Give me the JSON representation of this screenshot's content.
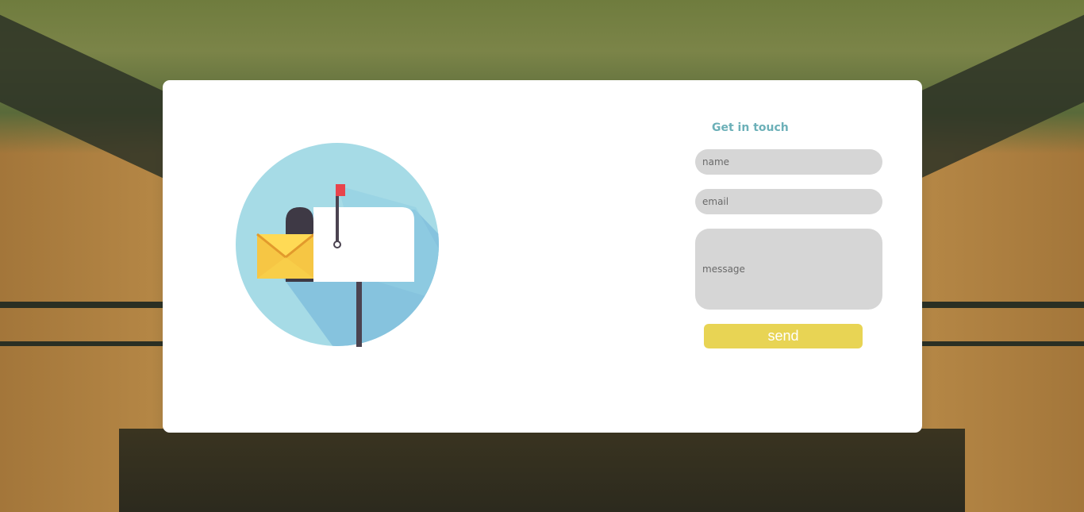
{
  "contact": {
    "title": "Get in touch",
    "name_placeholder": "name",
    "email_placeholder": "email",
    "message_placeholder": "message",
    "send_label": "send"
  },
  "illustration": {
    "icon": "mailbox-icon",
    "circle_color": "#a3dbe6",
    "accent_color": "#e8d454"
  }
}
